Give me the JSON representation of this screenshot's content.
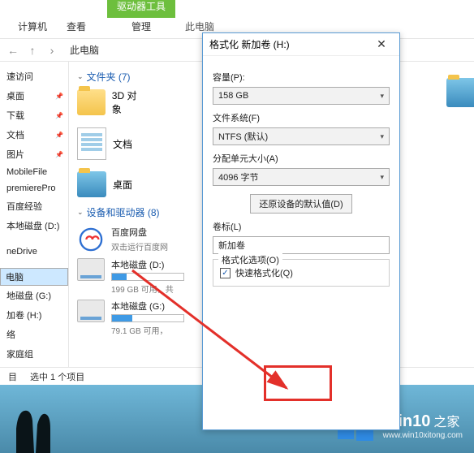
{
  "ribbon": {
    "tab_computer": "计算机",
    "tab_view": "查看",
    "tab_drive": "驱动器工具",
    "tab_manage": "管理",
    "context": "此电脑"
  },
  "address": {
    "location": "此电脑"
  },
  "sidebar": {
    "items": [
      {
        "label": "速访问"
      },
      {
        "label": "桌面"
      },
      {
        "label": "下载"
      },
      {
        "label": "文档"
      },
      {
        "label": "图片"
      },
      {
        "label": "MobileFile"
      },
      {
        "label": "premierePro"
      },
      {
        "label": "百度经验"
      },
      {
        "label": "本地磁盘 (D:)"
      }
    ],
    "g2": [
      {
        "label": "neDrive"
      }
    ],
    "g3": [
      {
        "label": "电脑",
        "sel": true
      },
      {
        "label": "地磁盘 (G:)"
      },
      {
        "label": "加卷 (H:)"
      },
      {
        "label": "络"
      },
      {
        "label": "家庭组"
      }
    ]
  },
  "content": {
    "folders_header": "文件夹 (7)",
    "folders": [
      {
        "label": "3D 对象"
      },
      {
        "label": "文档"
      },
      {
        "label": "桌面"
      }
    ],
    "drives_header": "设备和驱动器 (8)",
    "baidu": {
      "name": "百度网盘",
      "sub": "双击运行百度网"
    },
    "d": {
      "name": "本地磁盘 (D:)",
      "sub": "199 GB 可用，共",
      "pct": 20
    },
    "g": {
      "name": "本地磁盘 (G:)",
      "sub": "79.1 GB 可用，",
      "pct": 28
    }
  },
  "status": {
    "count": "目",
    "selected": "选中 1 个项目"
  },
  "dialog": {
    "title": "格式化 新加卷 (H:)",
    "cap_label": "容量(P):",
    "cap_value": "158 GB",
    "fs_label": "文件系统(F)",
    "fs_value": "NTFS (默认)",
    "au_label": "分配单元大小(A)",
    "au_value": "4096 字节",
    "restore_btn": "还原设备的默认值(D)",
    "vol_label": "卷标(L)",
    "vol_value": "新加卷",
    "opts_title": "格式化选项(O)",
    "quick": "快速格式化(Q)"
  },
  "watermark": {
    "brand": "Win10",
    "suffix": "之家",
    "url": "www.win10xitong.com"
  }
}
